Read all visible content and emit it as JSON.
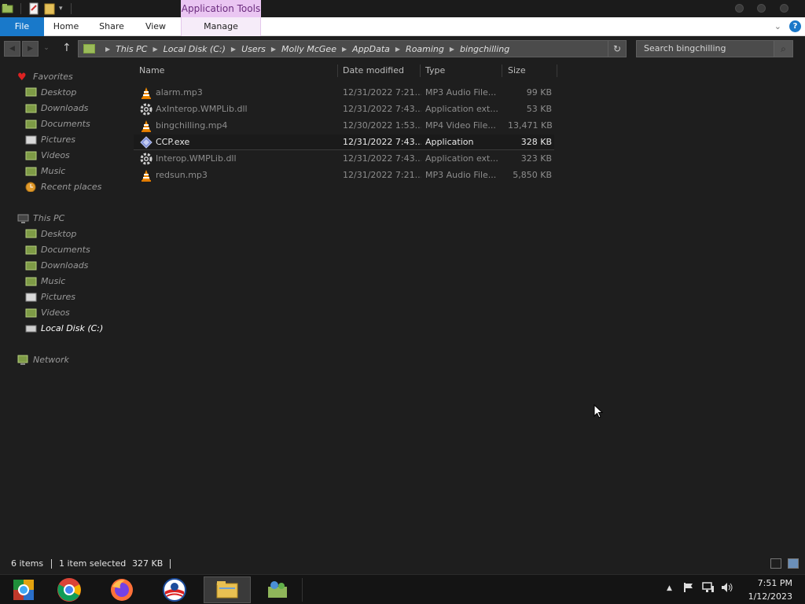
{
  "ribbon": {
    "context_group": "Application Tools",
    "tabs": [
      "File",
      "Home",
      "Share",
      "View",
      "Manage"
    ],
    "help_label": "?"
  },
  "breadcrumb": [
    "This PC",
    "Local Disk (C:)",
    "Users",
    "Molly McGee",
    "AppData",
    "Roaming",
    "bingchilling"
  ],
  "search": {
    "placeholder": "Search bingchilling"
  },
  "nav": {
    "favorites_label": "Favorites",
    "favorites": [
      "Desktop",
      "Downloads",
      "Documents",
      "Pictures",
      "Videos",
      "Music",
      "Recent places"
    ],
    "thispc_label": "This PC",
    "thispc": [
      "Desktop",
      "Documents",
      "Downloads",
      "Music",
      "Pictures",
      "Videos",
      "Local Disk (C:)"
    ],
    "network_label": "Network"
  },
  "columns": {
    "name": "Name",
    "date": "Date modified",
    "type": "Type",
    "size": "Size"
  },
  "files": [
    {
      "name": "alarm.mp3",
      "date": "12/31/2022 7:21...",
      "type": "MP3 Audio File...",
      "size": "99 KB",
      "icon": "vlc-cone-icon"
    },
    {
      "name": "AxInterop.WMPLib.dll",
      "date": "12/31/2022 7:43...",
      "type": "Application ext...",
      "size": "53 KB",
      "icon": "gear-icon"
    },
    {
      "name": "bingchilling.mp4",
      "date": "12/30/2022 1:53...",
      "type": "MP4 Video File...",
      "size": "13,471 KB",
      "icon": "vlc-cone-icon"
    },
    {
      "name": "CCP.exe",
      "date": "12/31/2022 7:43...",
      "type": "Application",
      "size": "328 KB",
      "icon": "diamond-icon",
      "selected": true
    },
    {
      "name": "Interop.WMPLib.dll",
      "date": "12/31/2022 7:43...",
      "type": "Application ext...",
      "size": "323 KB",
      "icon": "gear-icon"
    },
    {
      "name": "redsun.mp3",
      "date": "12/31/2022 7:21...",
      "type": "MP3 Audio File...",
      "size": "5,850 KB",
      "icon": "vlc-cone-icon"
    }
  ],
  "status": {
    "count": "6 items",
    "selected": "1 item selected",
    "size": "327 KB"
  },
  "clock": {
    "time": "7:51 PM",
    "date": "1/12/2023"
  },
  "colors": {
    "file_tab": "#1979ca",
    "context_tab": "#eac6f2",
    "window_bg": "#1e1e1e"
  }
}
